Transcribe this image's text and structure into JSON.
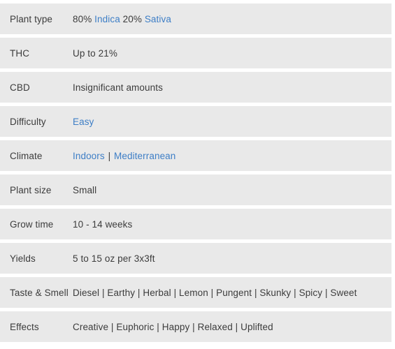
{
  "table": {
    "rows": [
      {
        "label": "Plant type",
        "value_text": "80% Indica 20% Sativa",
        "parts": [
          {
            "text": "80% ",
            "type": "plain"
          },
          {
            "text": "Indica",
            "type": "link"
          },
          {
            "text": " 20% ",
            "type": "plain"
          },
          {
            "text": "Sativa",
            "type": "link"
          }
        ]
      },
      {
        "label": "THC",
        "value_text": "Up to 21%",
        "parts": [
          {
            "text": "Up to 21%",
            "type": "plain"
          }
        ]
      },
      {
        "label": "CBD",
        "value_text": "Insignificant amounts",
        "parts": [
          {
            "text": "Insignificant amounts",
            "type": "plain"
          }
        ]
      },
      {
        "label": "Difficulty",
        "value_text": "Easy",
        "parts": [
          {
            "text": "Easy",
            "type": "link"
          }
        ]
      },
      {
        "label": "Climate",
        "value_text": "Indoors | Mediterranean",
        "parts": [
          {
            "text": "Indoors",
            "type": "link"
          },
          {
            "text": " | ",
            "type": "sep"
          },
          {
            "text": "Mediterranean",
            "type": "link"
          }
        ]
      },
      {
        "label": "Plant size",
        "value_text": "Small",
        "parts": [
          {
            "text": "Small",
            "type": "plain"
          }
        ]
      },
      {
        "label": "Grow time",
        "value_text": "10 - 14 weeks",
        "parts": [
          {
            "text": "10 - 14 weeks",
            "type": "plain"
          }
        ]
      },
      {
        "label": "Yields",
        "value_text": "5 to 15 oz per 3x3ft",
        "parts": [
          {
            "text": "5 to 15 oz per 3x3ft",
            "type": "plain"
          }
        ]
      },
      {
        "label": "Taste & Smell",
        "value_text": "Diesel | Earthy | Herbal | Lemon | Pungent | Skunky | Spicy | Sweet",
        "parts": [
          {
            "text": "Diesel | Earthy | Herbal | Lemon | Pungent | Skunky | Spicy | Sweet",
            "type": "plain"
          }
        ]
      },
      {
        "label": "Effects",
        "value_text": "Creative | Euphoric | Happy | Relaxed | Uplifted",
        "parts": [
          {
            "text": "Creative | Euphoric | Happy | Relaxed | Uplifted",
            "type": "plain"
          }
        ]
      }
    ]
  },
  "colors": {
    "row_background": "#e9e9e9",
    "page_background": "#ffffff",
    "text": "#3c3c3c",
    "link": "#3d7ec6"
  }
}
